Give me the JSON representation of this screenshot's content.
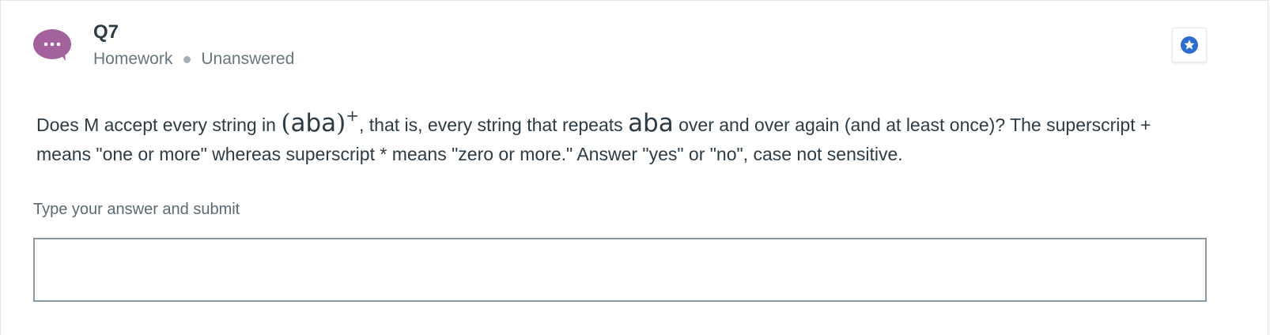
{
  "header": {
    "title": "Q7",
    "category": "Homework",
    "status": "Unanswered",
    "avatar_icon": "chat-bubble-icon",
    "flag_icon": "star-badge-icon"
  },
  "question": {
    "prefix": "Does M accept every string in ",
    "math_paren_open": "(",
    "math_term": "aba",
    "math_paren_close": ")",
    "math_sup": "+",
    "middle": ", that is, every string that repeats ",
    "math_term_2": "aba",
    "suffix": " over and over again (and at least once)? The superscript + means \"one or more\" whereas superscript * means \"zero or more.\" Answer \"yes\" or \"no\", case not sensitive."
  },
  "answer": {
    "label": "Type your answer and submit",
    "value": "",
    "placeholder": ""
  },
  "colors": {
    "avatar": "#a3629e",
    "flag": "#2b6dd1",
    "text": "#2d3b45",
    "muted": "#68777d"
  }
}
